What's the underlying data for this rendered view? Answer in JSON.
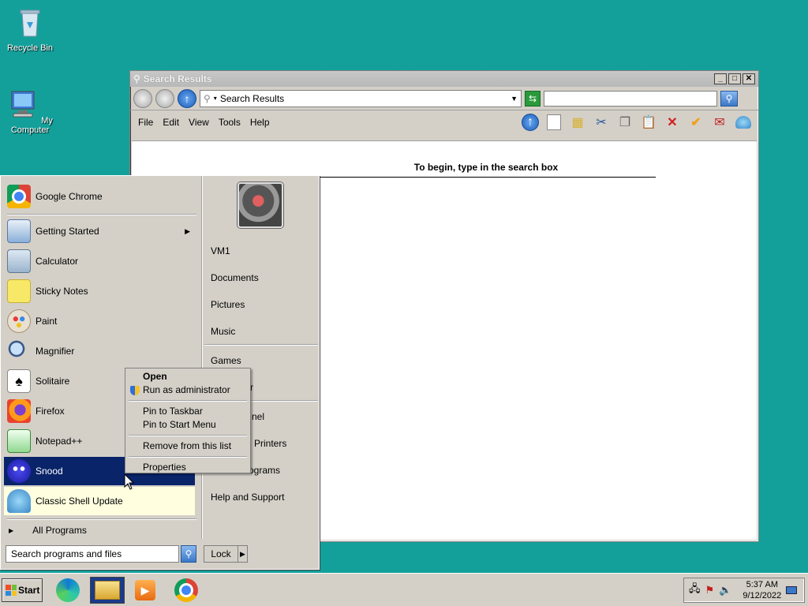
{
  "desktop": {
    "icons": [
      {
        "label": "Recycle Bin",
        "icon": "recycle-bin-icon"
      },
      {
        "label": "My Computer",
        "icon": "computer-icon"
      }
    ]
  },
  "window": {
    "title": "Search Results",
    "address": "Search Results",
    "search_value": "",
    "menu": [
      "File",
      "Edit",
      "View",
      "Tools",
      "Help"
    ],
    "hint": "To begin, type in the search box"
  },
  "startmenu": {
    "pinned": [
      {
        "label": "Google Chrome",
        "icon": "chrome-icon"
      }
    ],
    "recent": [
      {
        "label": "Getting Started",
        "icon": "getting-started-icon",
        "submenu": true
      },
      {
        "label": "Calculator",
        "icon": "calculator-icon"
      },
      {
        "label": "Sticky Notes",
        "icon": "sticky-notes-icon"
      },
      {
        "label": "Paint",
        "icon": "paint-icon"
      },
      {
        "label": "Magnifier",
        "icon": "magnifier-icon"
      },
      {
        "label": "Solitaire",
        "icon": "solitaire-icon"
      },
      {
        "label": "Firefox",
        "icon": "firefox-icon"
      },
      {
        "label": "Notepad++",
        "icon": "notepadpp-icon"
      },
      {
        "label": "Snood",
        "icon": "snood-icon"
      },
      {
        "label": "Classic Shell Update",
        "icon": "classic-shell-icon"
      }
    ],
    "all_programs": "All Programs",
    "search_placeholder": "Search programs and files",
    "lock": "Lock",
    "right": {
      "user": "VM1",
      "group1": [
        "Documents",
        "Pictures",
        "Music"
      ],
      "group2": [
        "Games",
        "ter"
      ],
      "group3": [
        "nel",
        "d Printers",
        "ograms",
        "Help and Support"
      ]
    }
  },
  "context_menu": {
    "items": [
      "Open",
      "Run as administrator",
      "Pin to Taskbar",
      "Pin to Start Menu",
      "Remove from this list",
      "Properties"
    ]
  },
  "taskbar": {
    "start": "Start",
    "time": "5:37 AM",
    "date": "9/12/2022"
  }
}
